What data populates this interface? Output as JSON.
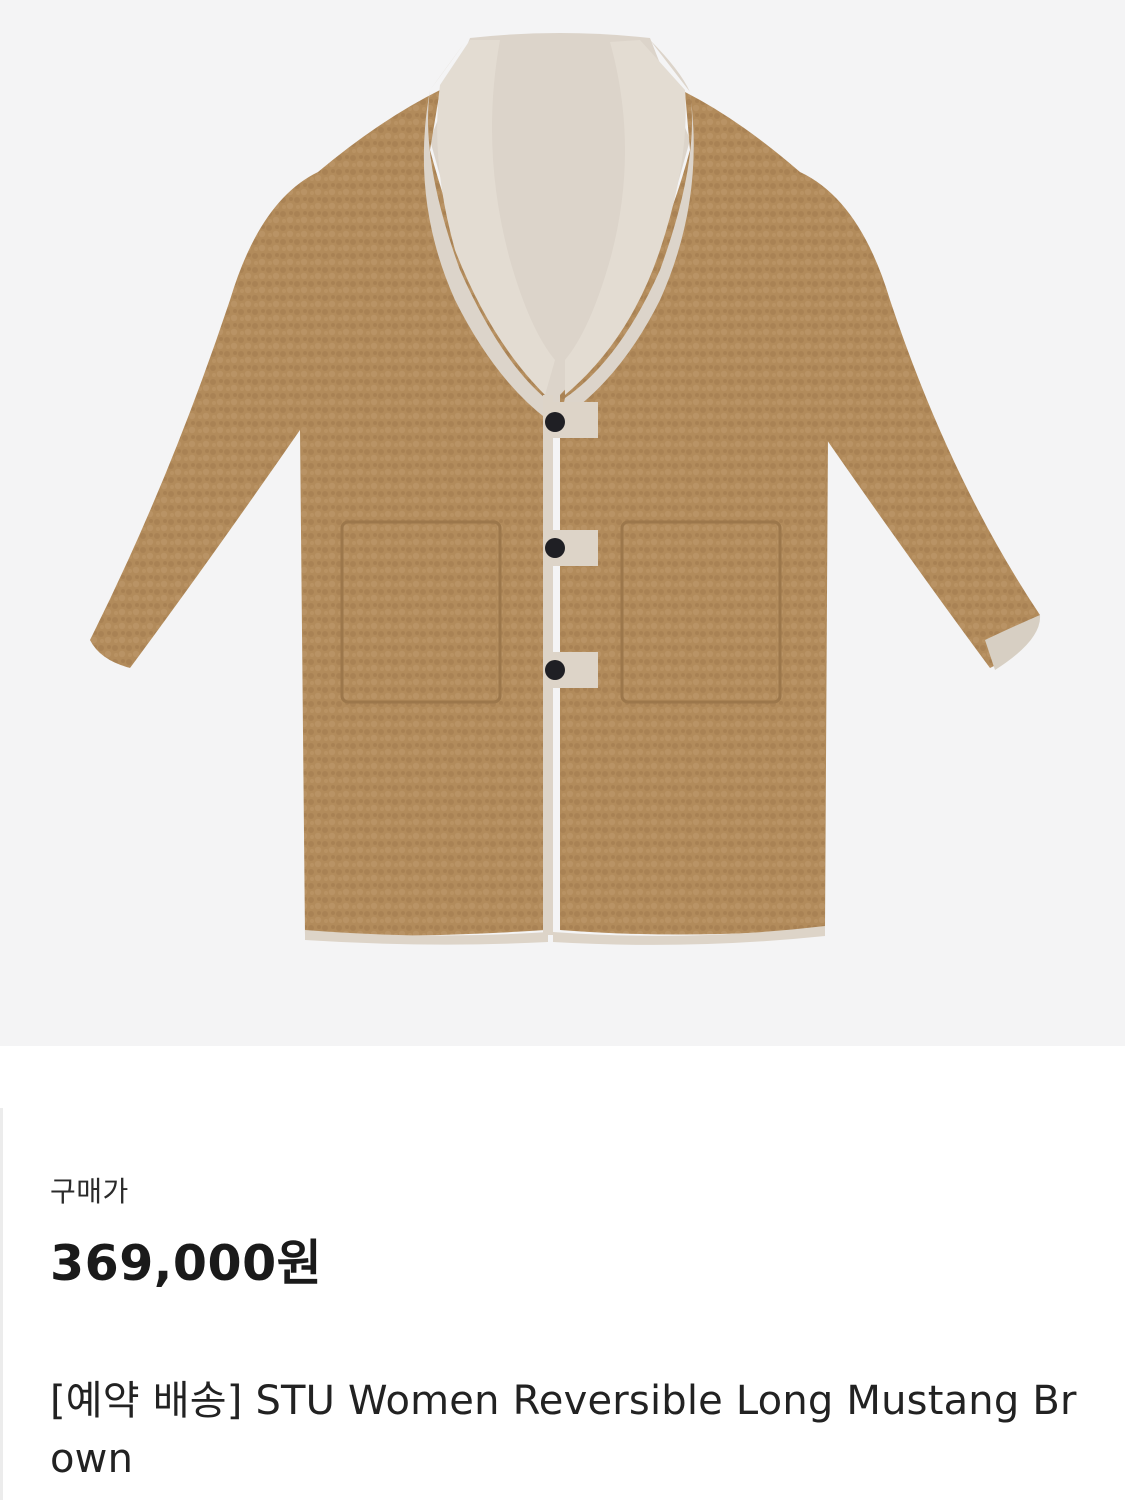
{
  "product": {
    "image_alt": "coat product photo",
    "price_label": "구매가",
    "price": "369,000원",
    "name": "[예약 배송] STU Women Reversible Long Mustang Brown"
  },
  "colors": {
    "image_background": "#f4f4f5",
    "fleece": "#b18a5a",
    "lining": "#ddd5cb"
  }
}
